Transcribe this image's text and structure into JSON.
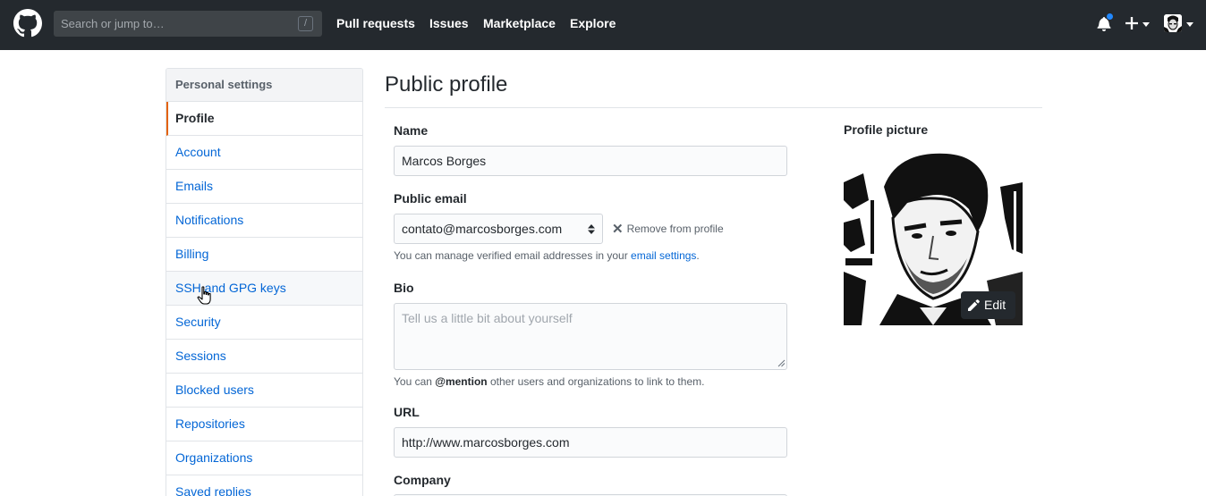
{
  "header": {
    "search_placeholder": "Search or jump to…",
    "search_shortcut": "/",
    "nav": [
      {
        "label": "Pull requests"
      },
      {
        "label": "Issues"
      },
      {
        "label": "Marketplace"
      },
      {
        "label": "Explore"
      }
    ],
    "icons": [
      "github-logo",
      "bell-icon",
      "plus-icon",
      "caret-down-icon",
      "avatar"
    ],
    "colors": {
      "background": "#24292e",
      "notification": "#2188ff"
    }
  },
  "sidebar": {
    "heading": "Personal settings",
    "items": [
      {
        "label": "Profile",
        "state": "selected"
      },
      {
        "label": "Account"
      },
      {
        "label": "Emails"
      },
      {
        "label": "Notifications"
      },
      {
        "label": "Billing"
      },
      {
        "label": "SSH and GPG keys",
        "state": "hovered"
      },
      {
        "label": "Security"
      },
      {
        "label": "Sessions"
      },
      {
        "label": "Blocked users"
      },
      {
        "label": "Repositories"
      },
      {
        "label": "Organizations"
      },
      {
        "label": "Saved replies"
      }
    ],
    "colors": {
      "link": "#0366d6",
      "selected_marker": "#e36209"
    }
  },
  "main": {
    "title": "Public profile",
    "name": {
      "label": "Name",
      "value": "Marcos Borges"
    },
    "public_email": {
      "label": "Public email",
      "value": "contato@marcosborges.com",
      "remove_label": "Remove from profile",
      "note_prefix": "You can manage verified email addresses in your ",
      "note_link": "email settings",
      "note_suffix": "."
    },
    "bio": {
      "label": "Bio",
      "placeholder": "Tell us a little bit about yourself",
      "note_prefix": "You can ",
      "note_mention": "@mention",
      "note_suffix": " other users and organizations to link to them."
    },
    "url": {
      "label": "URL",
      "value": "http://www.marcosborges.com"
    },
    "company": {
      "label": "Company"
    }
  },
  "profile_picture": {
    "label": "Profile picture",
    "edit_label": "Edit",
    "icons": [
      "pencil-icon"
    ]
  }
}
